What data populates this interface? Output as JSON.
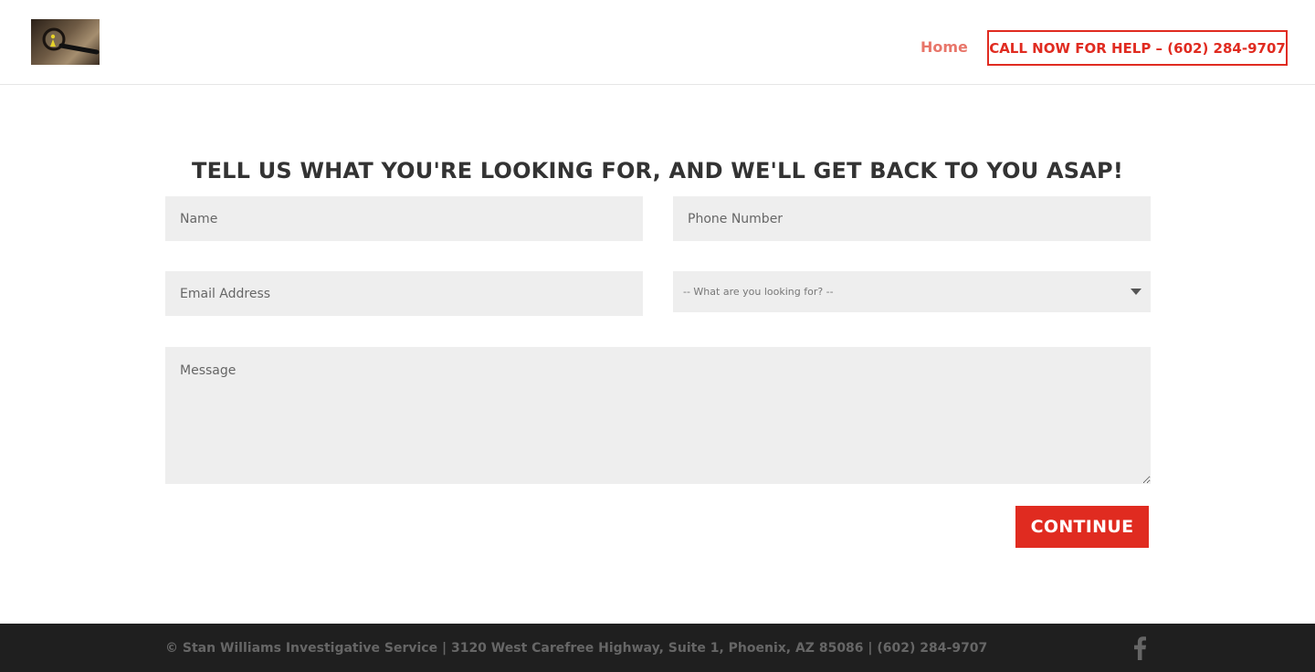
{
  "header": {
    "logo_alt": "Stan Williams Investigative Service logo",
    "nav": {
      "home_label": "Home"
    },
    "cta_label": "CALL NOW FOR HELP – (602) 284-9707"
  },
  "form": {
    "heading": "TELL US WHAT YOU'RE LOOKING FOR, AND WE'LL GET BACK TO YOU ASAP!",
    "name_placeholder": "Name",
    "phone_placeholder": "Phone Number",
    "email_placeholder": "Email Address",
    "select": {
      "selected": "-- What are you looking for? --"
    },
    "message_placeholder": "Message",
    "submit_label": "CONTINUE"
  },
  "footer": {
    "text": "© Stan Williams Investigative Service | 3120 West Carefree Highway, Suite 1, Phoenix, AZ 85086 | (602) 284-9707",
    "social": [
      "facebook-icon"
    ]
  },
  "colors": {
    "accent": "#e02b20",
    "nav_home": "#e8766a",
    "field_bg": "#eeeeee",
    "footer_bg": "#1f1f1f"
  }
}
